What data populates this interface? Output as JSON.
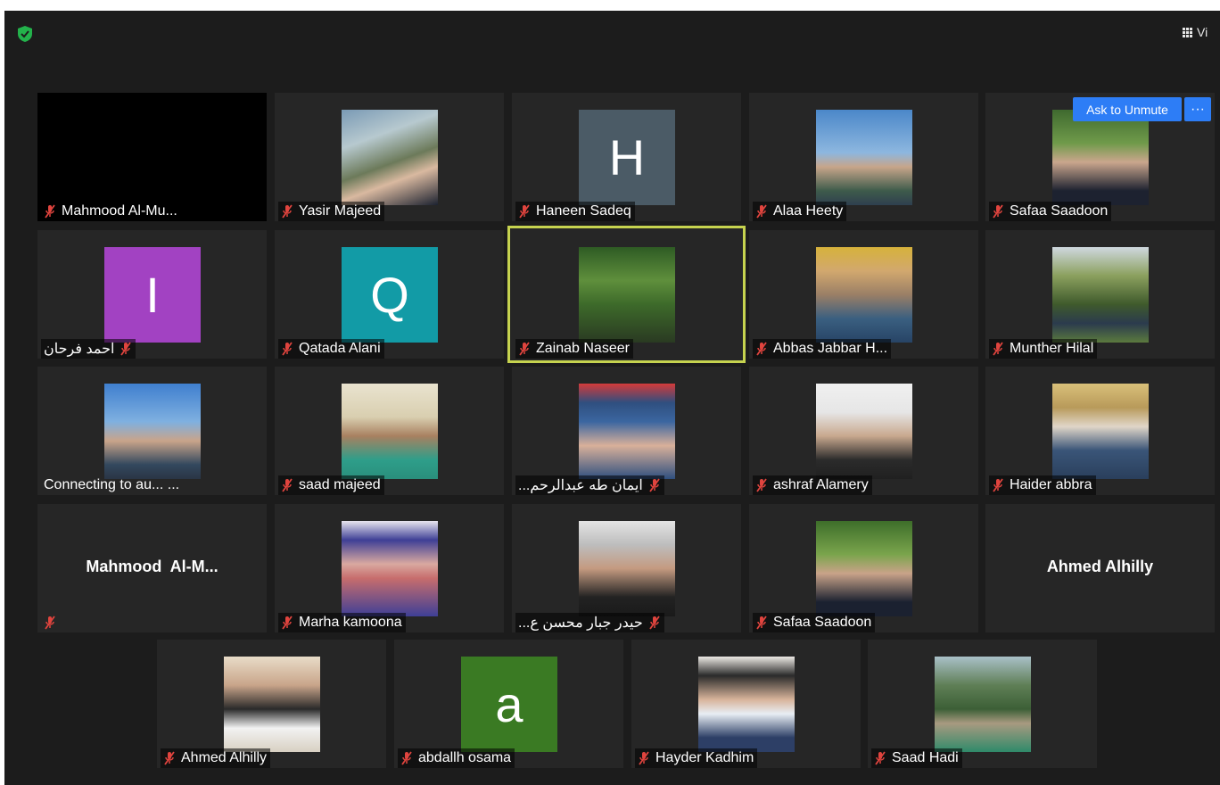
{
  "toolbar": {
    "view_label": "Vi"
  },
  "unmute_controls": {
    "ask_label": "Ask to Unmute",
    "more_label": "···"
  },
  "participants": [
    {
      "name": "Mahmood Al-Mu...",
      "label_style": "video-off"
    },
    {
      "name": "Yasir Majeed",
      "has_photo": true
    },
    {
      "name": "Haneen Sadeq",
      "initial": "H",
      "initial_color": "#4b5b66"
    },
    {
      "name": "Alaa Heety",
      "has_photo": true
    },
    {
      "name": "Safaa Saadoon",
      "has_photo": true
    },
    {
      "name": "احمد فرحان",
      "initial": "I",
      "initial_color": "#a242c2"
    },
    {
      "name": "Qatada Alani",
      "initial": "Q",
      "initial_color": "#129ba6"
    },
    {
      "name": "Zainab Naseer",
      "has_photo": true,
      "active_speaker": true
    },
    {
      "name": "Abbas Jabbar H...",
      "has_photo": true
    },
    {
      "name": "Munther Hilal",
      "has_photo": true
    },
    {
      "name": "Connecting to au... ...",
      "has_photo": true,
      "status": "connecting"
    },
    {
      "name": "saad majeed",
      "has_photo": true
    },
    {
      "name": "ايمان طه عبدالرحم...",
      "has_photo": true
    },
    {
      "name": "ashraf Alamery",
      "has_photo": true
    },
    {
      "name": "Haider abbra",
      "has_photo": true
    },
    {
      "name": "Mahmood  Al-M...",
      "name_only": true
    },
    {
      "name": "Marha kamoona",
      "has_photo": true
    },
    {
      "name": "حيدر جبار محسن ع...",
      "has_photo": true
    },
    {
      "name": "Safaa Saadoon",
      "has_photo": true
    },
    {
      "name": "Ahmed Alhilly",
      "name_only": true
    },
    {
      "name": "Ahmed Alhilly",
      "has_photo": true
    },
    {
      "name": "abdallh osama",
      "initial": "a",
      "initial_color": "#3a7a23"
    },
    {
      "name": "Hayder Kadhim",
      "has_photo": true
    },
    {
      "name": "Saad Hadi",
      "has_photo": true
    }
  ],
  "colors": {
    "background": "#1c1c1c",
    "tile": "#262626",
    "active_outline": "#c6d34f",
    "accent_button": "#2d7df6",
    "mute_icon": "#e0443e"
  },
  "icons": {
    "security": "shield-check-icon",
    "view": "grid-view-icon",
    "muted": "muted-mic-icon"
  }
}
